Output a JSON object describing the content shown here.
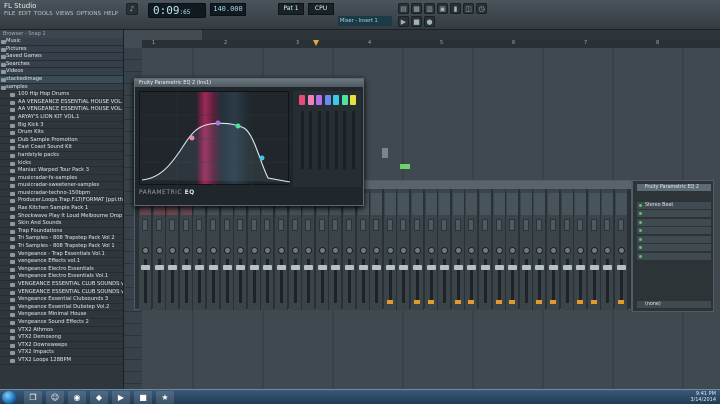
{
  "app": {
    "title": "FL Studio",
    "menu": [
      "FILE",
      "EDIT",
      "TOOLS",
      "VIEWS",
      "OPTIONS",
      "HELP"
    ]
  },
  "transport": {
    "time_main": "0:09",
    "time_sub": ":65",
    "pattern": "Pat 1",
    "cpu": "CPU",
    "monitor_label": "Mixer - Insert 1"
  },
  "browser": {
    "header": "Browser - Snap 1",
    "items": [
      {
        "label": "Music",
        "top": true
      },
      {
        "label": "Pictures",
        "top": true
      },
      {
        "label": "Saved Games",
        "top": true
      },
      {
        "label": "Searches",
        "top": true
      },
      {
        "label": "Videos",
        "top": true
      },
      {
        "label": "stackedimage",
        "top": true,
        "selected": true
      },
      {
        "label": "samples",
        "top": true
      },
      {
        "label": "100 Hip Hop Drums"
      },
      {
        "label": "AA VENGEANCE ESSENTIAL HOUSE VOL.1"
      },
      {
        "label": "AA VENGEANCE ESSENTIAL HOUSE VOL.2"
      },
      {
        "label": "ARYAY'S LION KIT VOL.1"
      },
      {
        "label": "Big Kick 3"
      },
      {
        "label": "Drum Kits"
      },
      {
        "label": "Dub Sample Promotion"
      },
      {
        "label": "East Coast Sound Kit"
      },
      {
        "label": "hardstyle packs"
      },
      {
        "label": "kicks"
      },
      {
        "label": "Maniac Warped Tour Pack 3"
      },
      {
        "label": "musicradar-fx-samples"
      },
      {
        "label": "musicradar-sweetener-samples"
      },
      {
        "label": "musicradar-techno-150bpm"
      },
      {
        "label": "Producer.Loops.Trap.F.LT(FORMAT [ppl.thl.ads]"
      },
      {
        "label": "Ras Kitchen Sample Pack 1"
      },
      {
        "label": "Shockwave Play It Loud Melbourne Drop Vol.3"
      },
      {
        "label": "Skin And Sounds"
      },
      {
        "label": "Trap Foundations"
      },
      {
        "label": "Tri Samples - 808 Trapstep Pack Vol 2"
      },
      {
        "label": "Tri Samples - 808 Trapstep Pack Vol 1"
      },
      {
        "label": "Vengeance - Trap Essentials Vol.1"
      },
      {
        "label": "vengeance Effects vol.1"
      },
      {
        "label": "Vengeance Electro Essentials"
      },
      {
        "label": "Vengeance Electro Essentials Vol.1"
      },
      {
        "label": "VENGEANCE ESSENTIAL CLUB SOUNDS vol-1"
      },
      {
        "label": "VENGEANCE ESSENTIAL CLUB SOUNDS vol-2"
      },
      {
        "label": "Vengeance Essential Clubsounds 3"
      },
      {
        "label": "Vengeance Essential Dubstep Vol.2"
      },
      {
        "label": "Vengeance Minimal House"
      },
      {
        "label": "Vengeance Sound Effects 2"
      },
      {
        "label": "VTX2 Athmos"
      },
      {
        "label": "VTX2 Demosong"
      },
      {
        "label": "VTX2 Downsweeps"
      },
      {
        "label": "VTX2 Impacts"
      },
      {
        "label": "VTX2 Loops 128BPM"
      }
    ]
  },
  "playlist": {
    "ruler": [
      "1",
      "2",
      "3",
      "4",
      "5",
      "6",
      "7",
      "8"
    ]
  },
  "eq": {
    "window_title": "Fruity Parametric EQ 2 (Ins1)",
    "label_dim": "PARAMETRIC",
    "label_bold": "EQ",
    "band_colors": [
      "#e84a7c",
      "#f080b8",
      "#b070e8",
      "#6a8af0",
      "#40c8e8",
      "#50e0a0",
      "#e8e040"
    ]
  },
  "mixer": {
    "side_title": "Fruity Parametric EQ 2",
    "slots": [
      "Fruity Parametric EQ 2",
      "Stereo Beat",
      "",
      "",
      "",
      "",
      "",
      ""
    ],
    "output": "(none)"
  },
  "taskbar": {
    "apps": [
      "❐",
      "☺",
      "◉",
      "◆",
      "▶",
      "■",
      "★"
    ],
    "time": "9:41 PM",
    "date": "3/14/2014"
  }
}
